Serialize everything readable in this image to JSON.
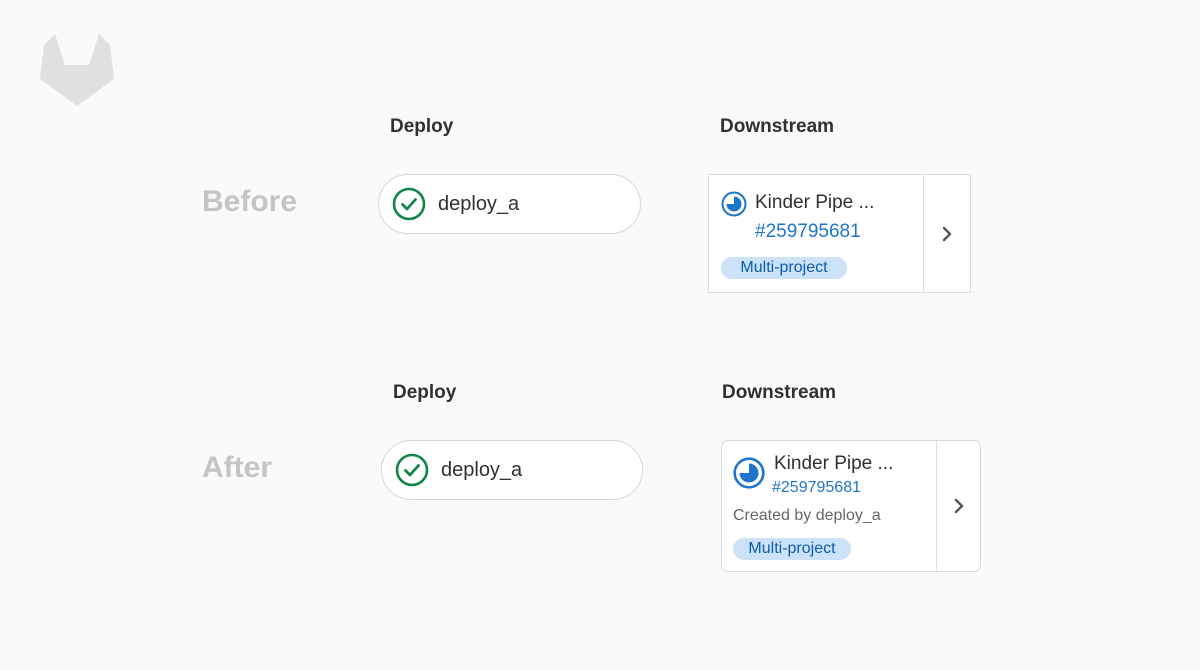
{
  "colors": {
    "background": "#fafafa",
    "success_green": "#108548",
    "link_blue": "#1f75cb",
    "badge_bg": "#cbe2f9",
    "badge_text": "#0b5cad",
    "muted_label": "#c4c4c4"
  },
  "logo": {
    "icon": "gitlab-tanuki-icon"
  },
  "before": {
    "row_label": "Before",
    "deploy_header": "Deploy",
    "downstream_header": "Downstream",
    "job": {
      "name": "deploy_a",
      "status_icon": "status-success-icon"
    },
    "pipeline": {
      "name": "Kinder Pipe ...",
      "id": "#259795681",
      "badge": "Multi-project",
      "status_icon": "status-running-icon",
      "expand_icon": "chevron-right-icon"
    }
  },
  "after": {
    "row_label": "After",
    "deploy_header": "Deploy",
    "downstream_header": "Downstream",
    "job": {
      "name": "deploy_a",
      "status_icon": "status-success-icon"
    },
    "pipeline": {
      "name": "Kinder Pipe ...",
      "id": "#259795681",
      "created_by": "Created by deploy_a",
      "badge": "Multi-project",
      "status_icon": "status-running-icon",
      "expand_icon": "chevron-right-icon"
    }
  }
}
